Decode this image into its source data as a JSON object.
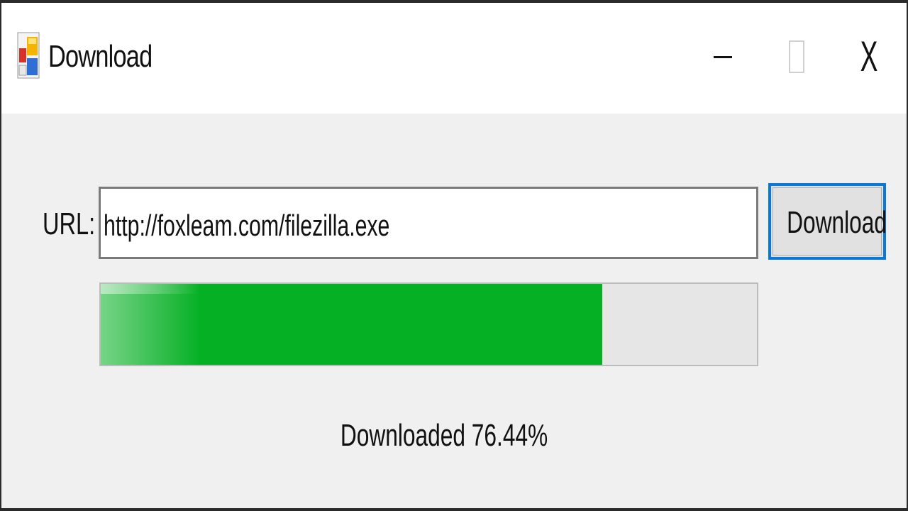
{
  "window": {
    "title": "Download",
    "controls": {
      "minimize_icon": "minimize-icon",
      "maximize_icon": "maximize-icon",
      "close_label": "X"
    },
    "app_icon": "application-icon"
  },
  "form": {
    "url_label": "URL:",
    "url_value": "http://foxleam.com/filezilla.exe",
    "download_button_label": "Download"
  },
  "progress": {
    "fraction": 0.7644,
    "fill_color": "#06b025",
    "status_text": "Downloaded 76.44%"
  },
  "colors": {
    "accent": "#0a78d7",
    "progress_fill": "#06b025",
    "window_background": "#f0f0f0",
    "titlebar_background": "#ffffff"
  }
}
